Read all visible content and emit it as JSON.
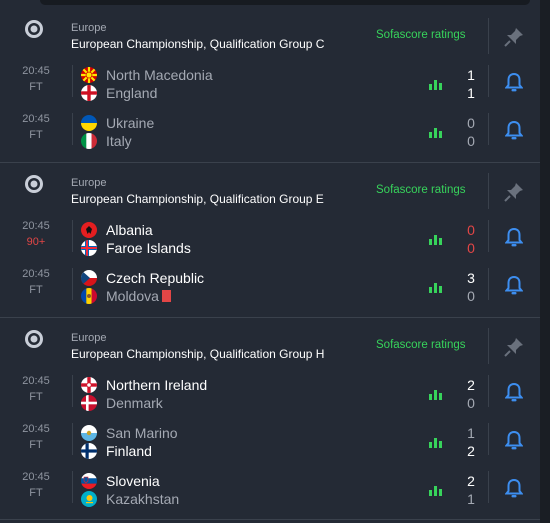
{
  "groups": [
    {
      "country": "Europe",
      "league": "European Championship, Qualification Group C",
      "rating_link": "Sofascore ratings",
      "matches": [
        {
          "time": "20:45",
          "status": "FT",
          "status_live": false,
          "home": "North Macedonia",
          "away": "England",
          "home_score": "1",
          "away_score": "1",
          "home_flag": "flag-north-macedonia",
          "away_flag": "flag-england"
        },
        {
          "time": "20:45",
          "status": "FT",
          "status_live": false,
          "home": "Ukraine",
          "away": "Italy",
          "home_score": "0",
          "away_score": "0",
          "home_flag": "flag-ukraine",
          "away_flag": "flag-italy"
        }
      ]
    },
    {
      "country": "Europe",
      "league": "European Championship, Qualification Group E",
      "rating_link": "Sofascore ratings",
      "matches": [
        {
          "time": "20:45",
          "status": "90+",
          "status_live": true,
          "home": "Albania",
          "away": "Faroe Islands",
          "home_score": "0",
          "away_score": "0",
          "home_flag": "flag-albania",
          "away_flag": "flag-faroe-islands"
        },
        {
          "time": "20:45",
          "status": "FT",
          "status_live": false,
          "home": "Czech Republic",
          "away": "Moldova",
          "home_score": "3",
          "away_score": "0",
          "home_flag": "flag-czech-republic",
          "away_flag": "flag-moldova",
          "away_red_card": true
        }
      ]
    },
    {
      "country": "Europe",
      "league": "European Championship, Qualification Group H",
      "rating_link": "Sofascore ratings",
      "matches": [
        {
          "time": "20:45",
          "status": "FT",
          "status_live": false,
          "home": "Northern Ireland",
          "away": "Denmark",
          "home_score": "2",
          "away_score": "0",
          "home_flag": "flag-northern-ireland",
          "away_flag": "flag-denmark"
        },
        {
          "time": "20:45",
          "status": "FT",
          "status_live": false,
          "home": "San Marino",
          "away": "Finland",
          "home_score": "1",
          "away_score": "2",
          "home_flag": "flag-san-marino",
          "away_flag": "flag-finland"
        },
        {
          "time": "20:45",
          "status": "FT",
          "status_live": false,
          "home": "Slovenia",
          "away": "Kazakhstan",
          "home_score": "2",
          "away_score": "1",
          "home_flag": "flag-slovenia",
          "away_flag": "flag-kazakhstan"
        }
      ]
    }
  ],
  "colors": {
    "background": "#242a35",
    "accent_green": "#37d35b",
    "bell_blue": "#3d8ef0",
    "live_red": "#e24646"
  }
}
